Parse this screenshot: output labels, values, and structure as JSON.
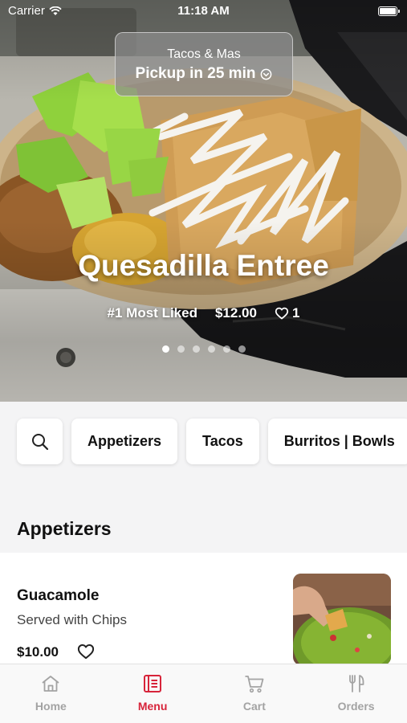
{
  "status_bar": {
    "carrier": "Carrier",
    "time": "11:18 AM"
  },
  "store": {
    "name": "Tacos & Mas",
    "pickup": "Pickup in 25 min"
  },
  "featured": {
    "title": "Quesadilla Entree",
    "badge": "#1 Most Liked",
    "price": "$12.00",
    "likes": "1",
    "page_count": 6,
    "active_page": 1
  },
  "categories": [
    "Appetizers",
    "Tacos",
    "Burritos | Bowls"
  ],
  "section": {
    "title": "Appetizers"
  },
  "items": [
    {
      "name": "Guacamole",
      "description": "Served with Chips",
      "price": "$10.00"
    }
  ],
  "tabs": [
    {
      "label": "Home",
      "icon": "home-icon",
      "active": false
    },
    {
      "label": "Menu",
      "icon": "menu-icon",
      "active": true
    },
    {
      "label": "Cart",
      "icon": "cart-icon",
      "active": false
    },
    {
      "label": "Orders",
      "icon": "utensils-icon",
      "active": false
    }
  ],
  "colors": {
    "accent": "#d7243a",
    "inactive": "#a3a3a3"
  }
}
